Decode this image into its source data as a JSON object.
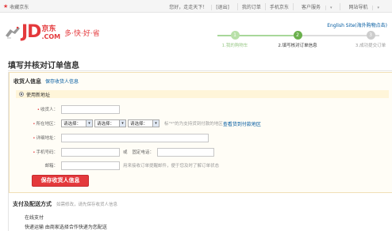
{
  "topbar": {
    "favorite_label": "收藏京东",
    "greeting": "您好，走走天下！",
    "logout": "[退出]",
    "my_orders": "我的订单",
    "mobile_jd": "手机京东",
    "customer_service": "客户服务",
    "site_nav": "网站导航"
  },
  "header": {
    "logo_jd": "JD",
    "logo_cn": "京东",
    "logo_com": ".COM",
    "slogan": "多·快·好·省",
    "english_site": "English Site(海外购物点击)"
  },
  "progress": {
    "steps": [
      {
        "num": "1",
        "label": "1.我的购物车"
      },
      {
        "num": "2",
        "label": "2.填写核对订单信息"
      },
      {
        "num": "3",
        "label": "3.成功提交订单"
      }
    ],
    "current_step": 2
  },
  "page_title": "填写并核对订单信息",
  "consignee": {
    "title": "收货人信息",
    "save_link": "保存收货人信息",
    "use_new_address": "使用新地址",
    "fields": {
      "name_label": "收货人：",
      "region_label": "所在地区：",
      "region_selects": [
        "请选择：",
        "请选择：",
        "请选择："
      ],
      "region_hint": "标\"*\"的为支持货到付款的地区",
      "region_link": "查看货到付款地区",
      "address_label": "详细地址：",
      "mobile_label": "手机号码：",
      "or_text": "或",
      "phone_label": "固定电话：",
      "email_label": "邮箱：",
      "email_hint": "用来接收订单提醒邮件，便于您及时了解订单状态"
    },
    "save_button": "保存收货人信息"
  },
  "payment": {
    "title": "支付及配送方式",
    "note": "如需修改，请先保存收货人信息",
    "method": "在线支付",
    "delivery": "快递运输  由商家选择合作快递为您配送"
  },
  "colors": {
    "brand_red": "#e4393c",
    "link_blue": "#005aa0",
    "progress_green": "#6ab04c"
  }
}
